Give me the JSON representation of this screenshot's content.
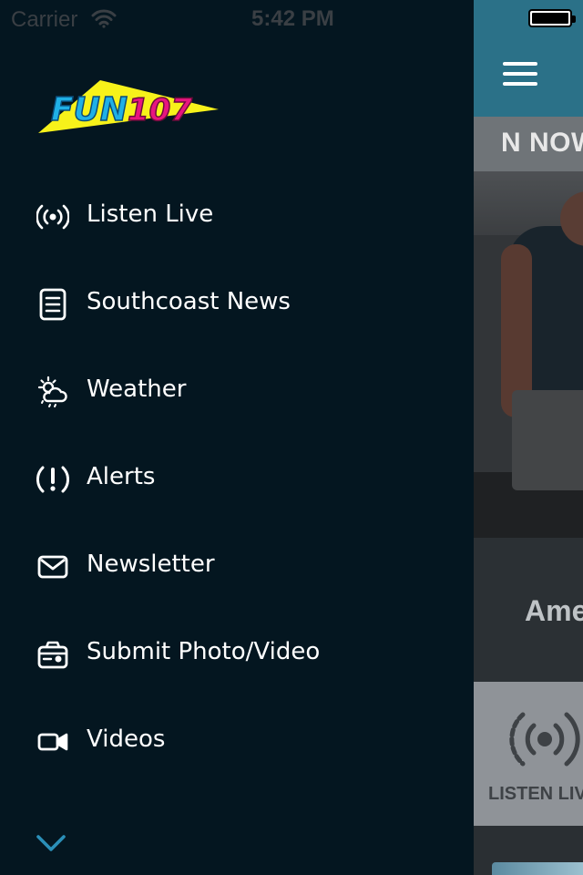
{
  "status_bar": {
    "carrier": "Carrier",
    "time": "5:42 PM"
  },
  "drawer": {
    "logo_text": "FUN107",
    "colors": {
      "background": "#041620",
      "accent_chevron": "#2b8fb8"
    },
    "menu": [
      {
        "label": "Listen Live",
        "icon": "broadcast-icon"
      },
      {
        "label": "Southcoast News",
        "icon": "document-icon"
      },
      {
        "label": "Weather",
        "icon": "weather-icon"
      },
      {
        "label": "Alerts",
        "icon": "alert-icon"
      },
      {
        "label": "Newsletter",
        "icon": "envelope-icon"
      },
      {
        "label": "Submit Photo/Video",
        "icon": "camera-icon"
      },
      {
        "label": "Videos",
        "icon": "video-camera-icon"
      }
    ]
  },
  "background_screen": {
    "ticker_text": "N NOW",
    "caption_text": "Ame",
    "listen_tile_label": "LISTEN LIV",
    "header_color": "#2b7188"
  }
}
